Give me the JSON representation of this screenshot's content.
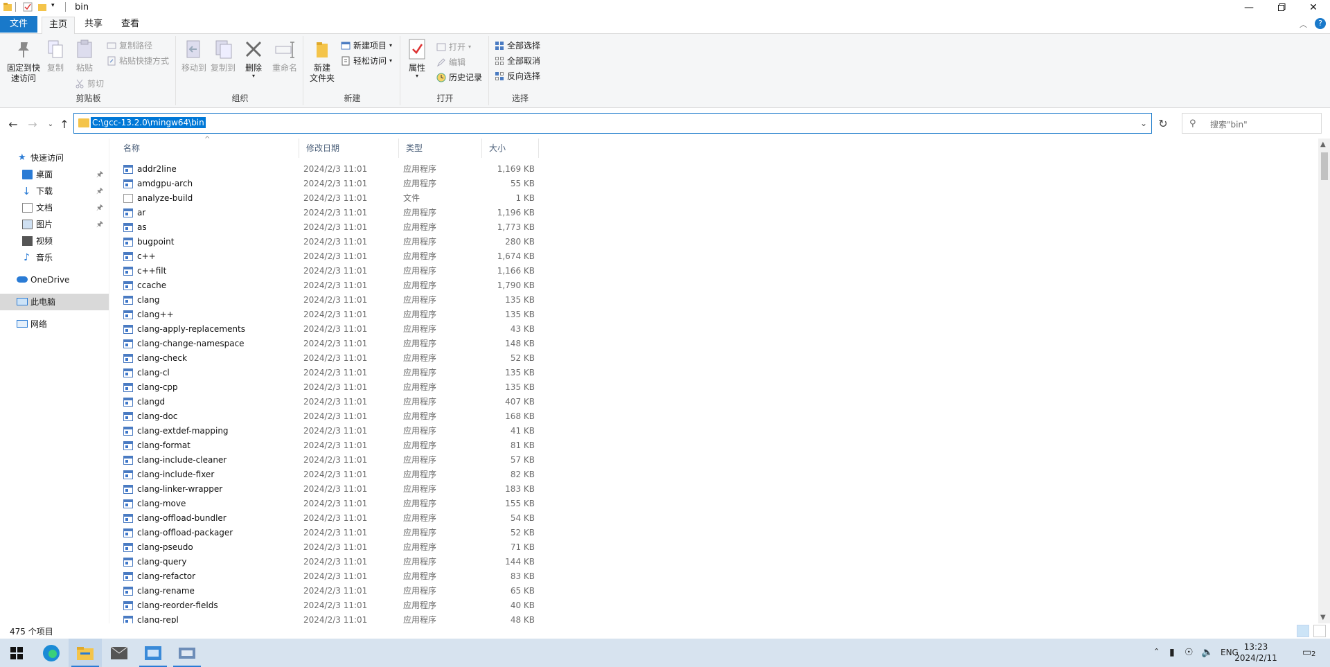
{
  "window": {
    "title": "bin"
  },
  "ribbon_tabs": [
    "文件",
    "主页",
    "共享",
    "查看"
  ],
  "ribbon": {
    "clipboard": {
      "pin_label_1": "固定到快",
      "pin_label_2": "速访问",
      "copy": "复制",
      "paste": "粘贴",
      "copy_path": "复制路径",
      "paste_shortcut": "粘贴快捷方式",
      "cut": "剪切",
      "group": "剪贴板"
    },
    "organize": {
      "move_to": "移动到",
      "copy_to": "复制到",
      "delete": "删除",
      "rename": "重命名",
      "group": "组织"
    },
    "new": {
      "new_item": "新建项目",
      "easy_access": "轻松访问",
      "new_folder_1": "新建",
      "new_folder_2": "文件夹",
      "group": "新建"
    },
    "open": {
      "properties": "属性",
      "open": "打开",
      "edit": "编辑",
      "history": "历史记录",
      "group": "打开"
    },
    "select": {
      "select_all": "全部选择",
      "select_none": "全部取消",
      "invert": "反向选择",
      "group": "选择"
    }
  },
  "address": {
    "path": "C:\\gcc-13.2.0\\mingw64\\bin"
  },
  "search": {
    "placeholder": "搜索\"bin\""
  },
  "nav": {
    "quick_access": "快速访问",
    "items": [
      "桌面",
      "下载",
      "文档",
      "图片",
      "视频",
      "音乐"
    ],
    "onedrive": "OneDrive",
    "this_pc": "此电脑",
    "network": "网络"
  },
  "columns": {
    "name": "名称",
    "date": "修改日期",
    "type": "类型",
    "size": "大小"
  },
  "files": [
    {
      "name": "addr2line",
      "date": "2024/2/3 11:01",
      "type": "应用程序",
      "size": "1,169 KB"
    },
    {
      "name": "amdgpu-arch",
      "date": "2024/2/3 11:01",
      "type": "应用程序",
      "size": "55 KB"
    },
    {
      "name": "analyze-build",
      "date": "2024/2/3 11:01",
      "type": "文件",
      "size": "1 KB"
    },
    {
      "name": "ar",
      "date": "2024/2/3 11:01",
      "type": "应用程序",
      "size": "1,196 KB"
    },
    {
      "name": "as",
      "date": "2024/2/3 11:01",
      "type": "应用程序",
      "size": "1,773 KB"
    },
    {
      "name": "bugpoint",
      "date": "2024/2/3 11:01",
      "type": "应用程序",
      "size": "280 KB"
    },
    {
      "name": "c++",
      "date": "2024/2/3 11:01",
      "type": "应用程序",
      "size": "1,674 KB"
    },
    {
      "name": "c++filt",
      "date": "2024/2/3 11:01",
      "type": "应用程序",
      "size": "1,166 KB"
    },
    {
      "name": "ccache",
      "date": "2024/2/3 11:01",
      "type": "应用程序",
      "size": "1,790 KB"
    },
    {
      "name": "clang",
      "date": "2024/2/3 11:01",
      "type": "应用程序",
      "size": "135 KB"
    },
    {
      "name": "clang++",
      "date": "2024/2/3 11:01",
      "type": "应用程序",
      "size": "135 KB"
    },
    {
      "name": "clang-apply-replacements",
      "date": "2024/2/3 11:01",
      "type": "应用程序",
      "size": "43 KB"
    },
    {
      "name": "clang-change-namespace",
      "date": "2024/2/3 11:01",
      "type": "应用程序",
      "size": "148 KB"
    },
    {
      "name": "clang-check",
      "date": "2024/2/3 11:01",
      "type": "应用程序",
      "size": "52 KB"
    },
    {
      "name": "clang-cl",
      "date": "2024/2/3 11:01",
      "type": "应用程序",
      "size": "135 KB"
    },
    {
      "name": "clang-cpp",
      "date": "2024/2/3 11:01",
      "type": "应用程序",
      "size": "135 KB"
    },
    {
      "name": "clangd",
      "date": "2024/2/3 11:01",
      "type": "应用程序",
      "size": "407 KB"
    },
    {
      "name": "clang-doc",
      "date": "2024/2/3 11:01",
      "type": "应用程序",
      "size": "168 KB"
    },
    {
      "name": "clang-extdef-mapping",
      "date": "2024/2/3 11:01",
      "type": "应用程序",
      "size": "41 KB"
    },
    {
      "name": "clang-format",
      "date": "2024/2/3 11:01",
      "type": "应用程序",
      "size": "81 KB"
    },
    {
      "name": "clang-include-cleaner",
      "date": "2024/2/3 11:01",
      "type": "应用程序",
      "size": "57 KB"
    },
    {
      "name": "clang-include-fixer",
      "date": "2024/2/3 11:01",
      "type": "应用程序",
      "size": "82 KB"
    },
    {
      "name": "clang-linker-wrapper",
      "date": "2024/2/3 11:01",
      "type": "应用程序",
      "size": "183 KB"
    },
    {
      "name": "clang-move",
      "date": "2024/2/3 11:01",
      "type": "应用程序",
      "size": "155 KB"
    },
    {
      "name": "clang-offload-bundler",
      "date": "2024/2/3 11:01",
      "type": "应用程序",
      "size": "54 KB"
    },
    {
      "name": "clang-offload-packager",
      "date": "2024/2/3 11:01",
      "type": "应用程序",
      "size": "52 KB"
    },
    {
      "name": "clang-pseudo",
      "date": "2024/2/3 11:01",
      "type": "应用程序",
      "size": "71 KB"
    },
    {
      "name": "clang-query",
      "date": "2024/2/3 11:01",
      "type": "应用程序",
      "size": "144 KB"
    },
    {
      "name": "clang-refactor",
      "date": "2024/2/3 11:01",
      "type": "应用程序",
      "size": "83 KB"
    },
    {
      "name": "clang-rename",
      "date": "2024/2/3 11:01",
      "type": "应用程序",
      "size": "65 KB"
    },
    {
      "name": "clang-reorder-fields",
      "date": "2024/2/3 11:01",
      "type": "应用程序",
      "size": "40 KB"
    },
    {
      "name": "clang-repl",
      "date": "2024/2/3 11:01",
      "type": "应用程序",
      "size": "48 KB"
    }
  ],
  "status": {
    "count": "475 个项目"
  },
  "taskbar": {
    "lang": "ENG",
    "time": "13:23",
    "date": "2024/2/11",
    "notifications": "2"
  },
  "colors": {
    "accent": "#1979ca",
    "selection": "#0078d7",
    "folder": "#f4c44a"
  }
}
